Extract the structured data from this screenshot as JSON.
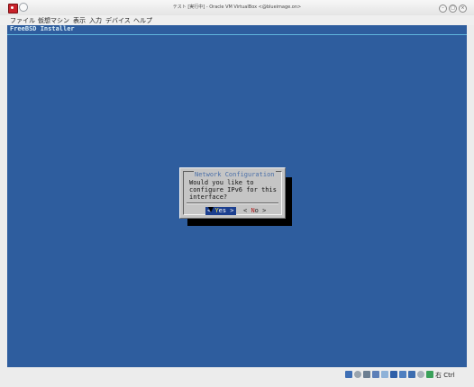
{
  "window": {
    "title": "テスト [実行中] - Oracle VM VirtualBox <@blueimage.on>"
  },
  "menubar": {
    "items": [
      "ファイル",
      "仮想マシン",
      "表示",
      "入力",
      "デバイス",
      "ヘルプ"
    ]
  },
  "vm": {
    "installer_title": "FreeBSD Installer",
    "dialog": {
      "title": "Network Configuration",
      "message": "Would you like to\nconfigure IPv6 for this\ninterface?",
      "yes_label": "< Yes >",
      "no_label": "< No  >"
    }
  },
  "statusbar": {
    "host_key_label": "右 Ctrl",
    "icons": [
      "harddisk-icon",
      "optical-disc-icon",
      "usb-icon",
      "shared-folder-icon",
      "display-icon",
      "video-capture-icon",
      "network-icon",
      "mouse-integration-icon",
      "cpu-icon",
      "arrow-icon"
    ]
  },
  "colors": {
    "vm_background": "#2e5d9e",
    "dialog_background": "#c5c5c5",
    "selected_button": "#1c3f8f"
  }
}
